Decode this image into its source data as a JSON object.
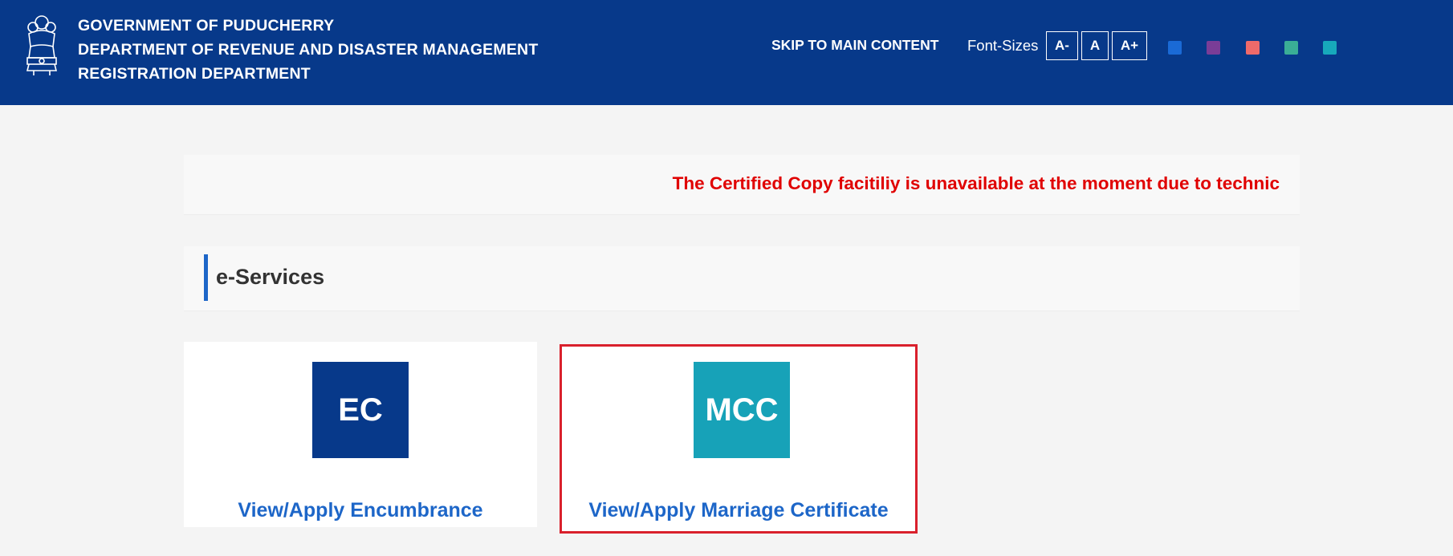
{
  "header": {
    "org_lines": [
      "GOVERNMENT OF PUDUCHERRY",
      "DEPARTMENT OF REVENUE AND DISASTER MANAGEMENT",
      "REGISTRATION DEPARTMENT"
    ],
    "emblem_icon": "national-emblem-icon",
    "skip_link": "SKIP TO MAIN CONTENT",
    "font_sizes_label": "Font-Sizes",
    "font_buttons": [
      "A-",
      "A",
      "A+"
    ],
    "theme_colors": [
      "#1a6ad6",
      "#7a3d97",
      "#ee6a6a",
      "#3aae96",
      "#17a9bb"
    ]
  },
  "notice": {
    "text": "The Certified Copy facitiliy is unavailable at the moment due to technic",
    "color": "#e00000"
  },
  "services": {
    "title": "e-Services",
    "cards": [
      {
        "tile_text": "EC",
        "link": "View/Apply Encumbrance",
        "tile_color": "#07398a"
      },
      {
        "tile_text": "MCC",
        "link": "View/Apply Marriage Certificate",
        "tile_color": "#17a2b8"
      }
    ]
  },
  "colors": {
    "header_bg": "#07398a",
    "accent": "#1d66c8",
    "highlight_border": "#d9202c"
  }
}
